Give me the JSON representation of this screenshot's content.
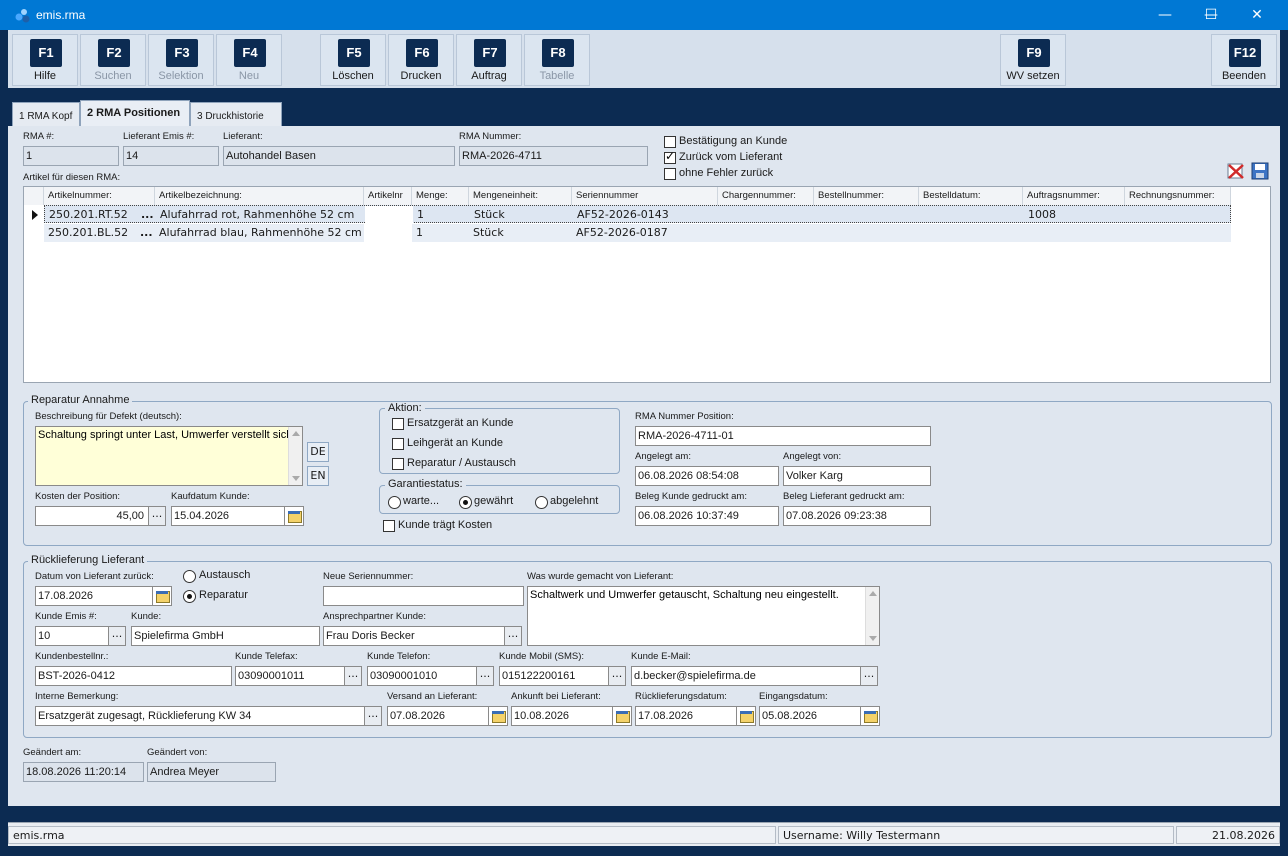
{
  "window": {
    "title": "emis.rma",
    "minimize": "—",
    "maximize": "☐",
    "close": "✕"
  },
  "toolbar": {
    "f1": {
      "key": "F1",
      "label": "Hilfe"
    },
    "f2": {
      "key": "F2",
      "label": "Suchen"
    },
    "f3": {
      "key": "F3",
      "label": "Selektion"
    },
    "f4": {
      "key": "F4",
      "label": "Neu"
    },
    "f5": {
      "key": "F5",
      "label": "Löschen"
    },
    "f6": {
      "key": "F6",
      "label": "Drucken"
    },
    "f7": {
      "key": "F7",
      "label": "Auftrag"
    },
    "f8": {
      "key": "F8",
      "label": "Tabelle"
    },
    "f9": {
      "key": "F9",
      "label": "WV setzen"
    },
    "f12": {
      "key": "F12",
      "label": "Beenden"
    }
  },
  "tabs": {
    "t1": "1 RMA Kopf",
    "t2": "2 RMA Positionen",
    "t3": "3 Druckhistorie"
  },
  "header": {
    "rma_label": "RMA #:",
    "rma_value": "1",
    "lief_emis_label": "Lieferant Emis #:",
    "lief_emis_value": "14",
    "lieferant_label": "Lieferant:",
    "lieferant_value": "Autohandel Basen",
    "rma_nummer_label": "RMA Nummer:",
    "rma_nummer_value": "RMA-2026-4711",
    "chk_bestaetigung": "Bestätigung an Kunde",
    "chk_zurueck": "Zurück vom Lieferant",
    "chk_ohne_fehler": "ohne Fehler zurück",
    "artikel_label": "Artikel für diesen RMA:"
  },
  "grid": {
    "columns": [
      "Artikelnummer:",
      "Artikelbezeichnung:",
      "Artikelnr",
      "Menge:",
      "Mengeneinheit:",
      "Seriennummer",
      "Chargennummer:",
      "Bestellnummer:",
      "Bestelldatum:",
      "Auftragsnummer:",
      "Rechnungsnummer:"
    ],
    "rows": [
      {
        "artnr": "250.201.RT.52",
        "bez": "Alufahrrad rot, Rahmenhöhe 52 cm",
        "menge": "1",
        "einheit": "Stück",
        "serie": "AF52-2026-0143",
        "auftrag": "1008"
      },
      {
        "artnr": "250.201.BL.52",
        "bez": "Alufahrrad blau, Rahmenhöhe 52 cm",
        "menge": "1",
        "einheit": "Stück",
        "serie": "AF52-2026-0187",
        "auftrag": ""
      }
    ]
  },
  "reparatur": {
    "title": "Reparatur Annahme",
    "beschreibung_label": "Beschreibung für Defekt (deutsch):",
    "beschreibung_value": "Schaltung springt unter Last, Umwerfer verstellt sich.",
    "de": "DE",
    "en": "EN",
    "kosten_label": "Kosten der Position:",
    "kosten_value": "45,00",
    "kaufdatum_label": "Kaufdatum Kunde:",
    "kaufdatum_value": "15.04.2026",
    "aktion_title": "Aktion:",
    "aktion_ersatz": "Ersatzgerät an Kunde",
    "aktion_leih": "Leihgerät an Kunde",
    "aktion_rep": "Reparatur / Austausch",
    "garantie_title": "Garantiestatus:",
    "g_warte": "warte...",
    "g_gewaehrt": "gewährt",
    "g_abgelehnt": "abgelehnt",
    "kunde_kosten": "Kunde trägt Kosten",
    "rma_pos_label": "RMA Nummer Position:",
    "rma_pos_value": "RMA-2026-4711-01",
    "angelegt_am_label": "Angelegt am:",
    "angelegt_am_value": "06.08.2026 08:54:08",
    "angelegt_von_label": "Angelegt von:",
    "angelegt_von_value": "Volker Karg",
    "beleg_kunde_label": "Beleg Kunde gedruckt am:",
    "beleg_kunde_value": "06.08.2026 10:37:49",
    "beleg_lief_label": "Beleg Lieferant gedruckt am:",
    "beleg_lief_value": "07.08.2026 09:23:38"
  },
  "rueck": {
    "title": "Rücklieferung Lieferant",
    "datum_label": "Datum von Lieferant zurück:",
    "datum_value": "17.08.2026",
    "r_austausch": "Austausch",
    "r_reparatur": "Reparatur",
    "neue_sn_label": "Neue Seriennummer:",
    "neue_sn_value": "",
    "was_label": "Was wurde gemacht von Lieferant:",
    "was_value": "Schaltwerk und Umwerfer getauscht, Schaltung neu eingestellt.",
    "kunde_emis_label": "Kunde Emis #:",
    "kunde_emis_value": "10",
    "kunde_label": "Kunde:",
    "kunde_value": "Spielefirma GmbH",
    "ansprech_label": "Ansprechpartner Kunde:",
    "ansprech_value": "Frau Doris Becker",
    "bestellnr_label": "Kundenbestellnr.:",
    "bestellnr_value": "BST-2026-0412",
    "fax_label": "Kunde Telefax:",
    "fax_value": "03090001011",
    "tel_label": "Kunde Telefon:",
    "tel_value": "03090001010",
    "mobil_label": "Kunde Mobil (SMS):",
    "mobil_value": "015122200161",
    "email_label": "Kunde E-Mail:",
    "email_value": "d.becker@spielefirma.de",
    "bem_label": "Interne Bemerkung:",
    "bem_value": "Ersatzgerät zugesagt, Rücklieferung KW 34",
    "versand_label": "Versand an Lieferant:",
    "versand_value": "07.08.2026",
    "ankunft_label": "Ankunft bei Lieferant:",
    "ankunft_value": "10.08.2026",
    "rueckdat_label": "Rücklieferungsdatum:",
    "rueckdat_value": "17.08.2026",
    "eingang_label": "Eingangsdatum:",
    "eingang_value": "05.08.2026"
  },
  "footer": {
    "geaendert_am_label": "Geändert am:",
    "geaendert_am_value": "18.08.2026 11:20:14",
    "geaendert_von_label": "Geändert von:",
    "geaendert_von_value": "Andrea Meyer"
  },
  "status": {
    "app": "emis.rma",
    "user": "Username: Willy Testermann",
    "date": "21.08.2026"
  },
  "colors": {
    "accent": "#0078d4",
    "navy": "#0c2b52",
    "panel": "#dfe6ef"
  }
}
